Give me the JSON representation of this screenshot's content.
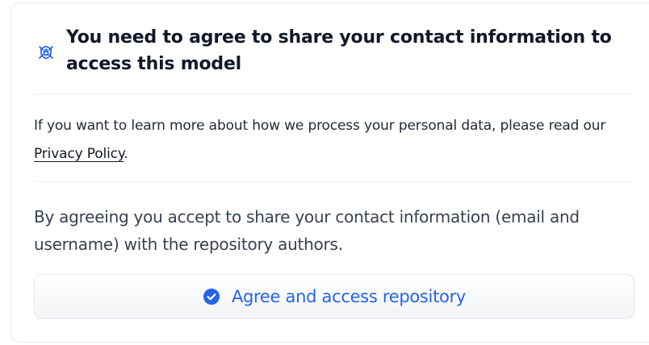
{
  "gate": {
    "icon": "gated-lock-icon",
    "title": "You need to agree to share your contact information to access this model"
  },
  "privacy": {
    "text_before": "If you want to learn more about how we process your personal data, please read our",
    "link_label": "Privacy Policy",
    "text_after": "."
  },
  "consent": {
    "text": "By agreeing you accept to share your contact information (email and username) with the repository authors."
  },
  "action": {
    "icon": "check-circle-icon",
    "label": "Agree and access repository",
    "accent_color": "#2563eb"
  }
}
